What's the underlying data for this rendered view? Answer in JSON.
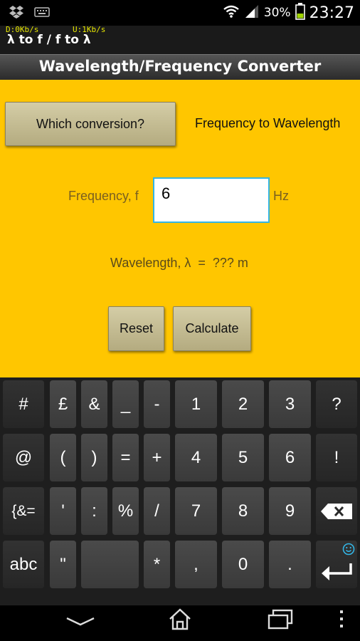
{
  "status_bar": {
    "battery_text": "30%",
    "time": "23:27",
    "download_speed": "D:0Kb/s",
    "upload_speed": "U:1Kb/s"
  },
  "app": {
    "title": "λ to f / f to λ",
    "header": "Wavelength/Frequency Converter"
  },
  "converter": {
    "which_button": "Which conversion?",
    "mode_text": "Frequency to Wavelength",
    "frequency_label": "Frequency, f",
    "frequency_value": "6",
    "frequency_unit": "Hz",
    "result_text": "Wavelength, λ  =  ??? m",
    "reset_button": "Reset",
    "calculate_button": "Calculate"
  },
  "keyboard": {
    "row1": [
      "#",
      "£",
      "&",
      "_",
      "-",
      "1",
      "2",
      "3",
      "?"
    ],
    "row2": [
      "@",
      "(",
      ")",
      "=",
      "+",
      "4",
      "5",
      "6",
      "!"
    ],
    "row3": [
      "{&=",
      "'",
      ":",
      "%",
      "/",
      "7",
      "8",
      "9"
    ],
    "row4": [
      "abc",
      "\"",
      "*",
      ",",
      "0",
      "."
    ]
  },
  "colors": {
    "content_bg": "#ffc600",
    "input_focus": "#33b5e5"
  }
}
